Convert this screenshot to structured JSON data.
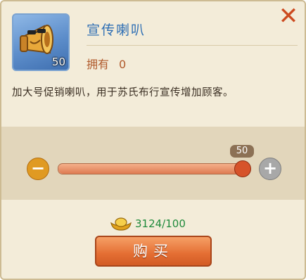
{
  "item": {
    "title": "宣传喇叭",
    "owned_label": "拥有",
    "owned_value": "0",
    "icon_quantity": "50",
    "icon": "megaphone-icon",
    "description": "加大号促销喇叭，用于苏氏布行宣传增加顾客。"
  },
  "quantity": {
    "value": "50",
    "fraction": 1.0,
    "minus_icon": "minus-icon",
    "plus_icon": "plus-icon"
  },
  "cost": {
    "currency_icon": "gold-ingot-icon",
    "text": "3124/100"
  },
  "buy_label": "购买",
  "close_icon": "close-icon",
  "colors": {
    "title": "#2f6fb4",
    "accent": "#e46e33",
    "price": "#1f8a3b"
  }
}
